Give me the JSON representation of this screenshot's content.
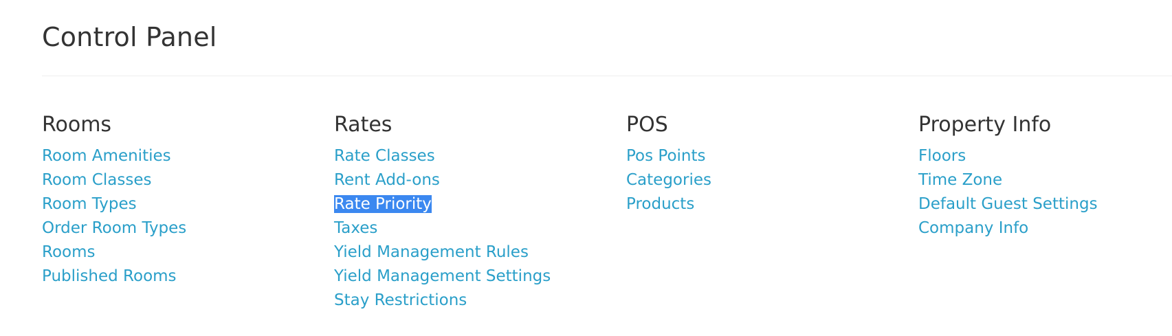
{
  "page": {
    "title": "Control Panel"
  },
  "sections": [
    {
      "heading": "Rooms",
      "links": [
        "Room Amenities",
        "Room Classes",
        "Room Types",
        "Order Room Types",
        "Rooms",
        "Published Rooms"
      ]
    },
    {
      "heading": "Rates",
      "links": [
        "Rate Classes",
        "Rent Add-ons",
        "Rate Priority",
        "Taxes",
        "Yield Management Rules",
        "Yield Management Settings",
        "Stay Restrictions"
      ]
    },
    {
      "heading": "POS",
      "links": [
        "Pos Points",
        "Categories",
        "Products"
      ]
    },
    {
      "heading": "Property Info",
      "links": [
        "Floors",
        "Time Zone",
        "Default Guest Settings",
        "Company Info"
      ]
    }
  ],
  "colors": {
    "link": "#2a9fc9",
    "heading": "#333333",
    "selection_background": "#3b88f0",
    "selection_text": "#ffffff"
  }
}
